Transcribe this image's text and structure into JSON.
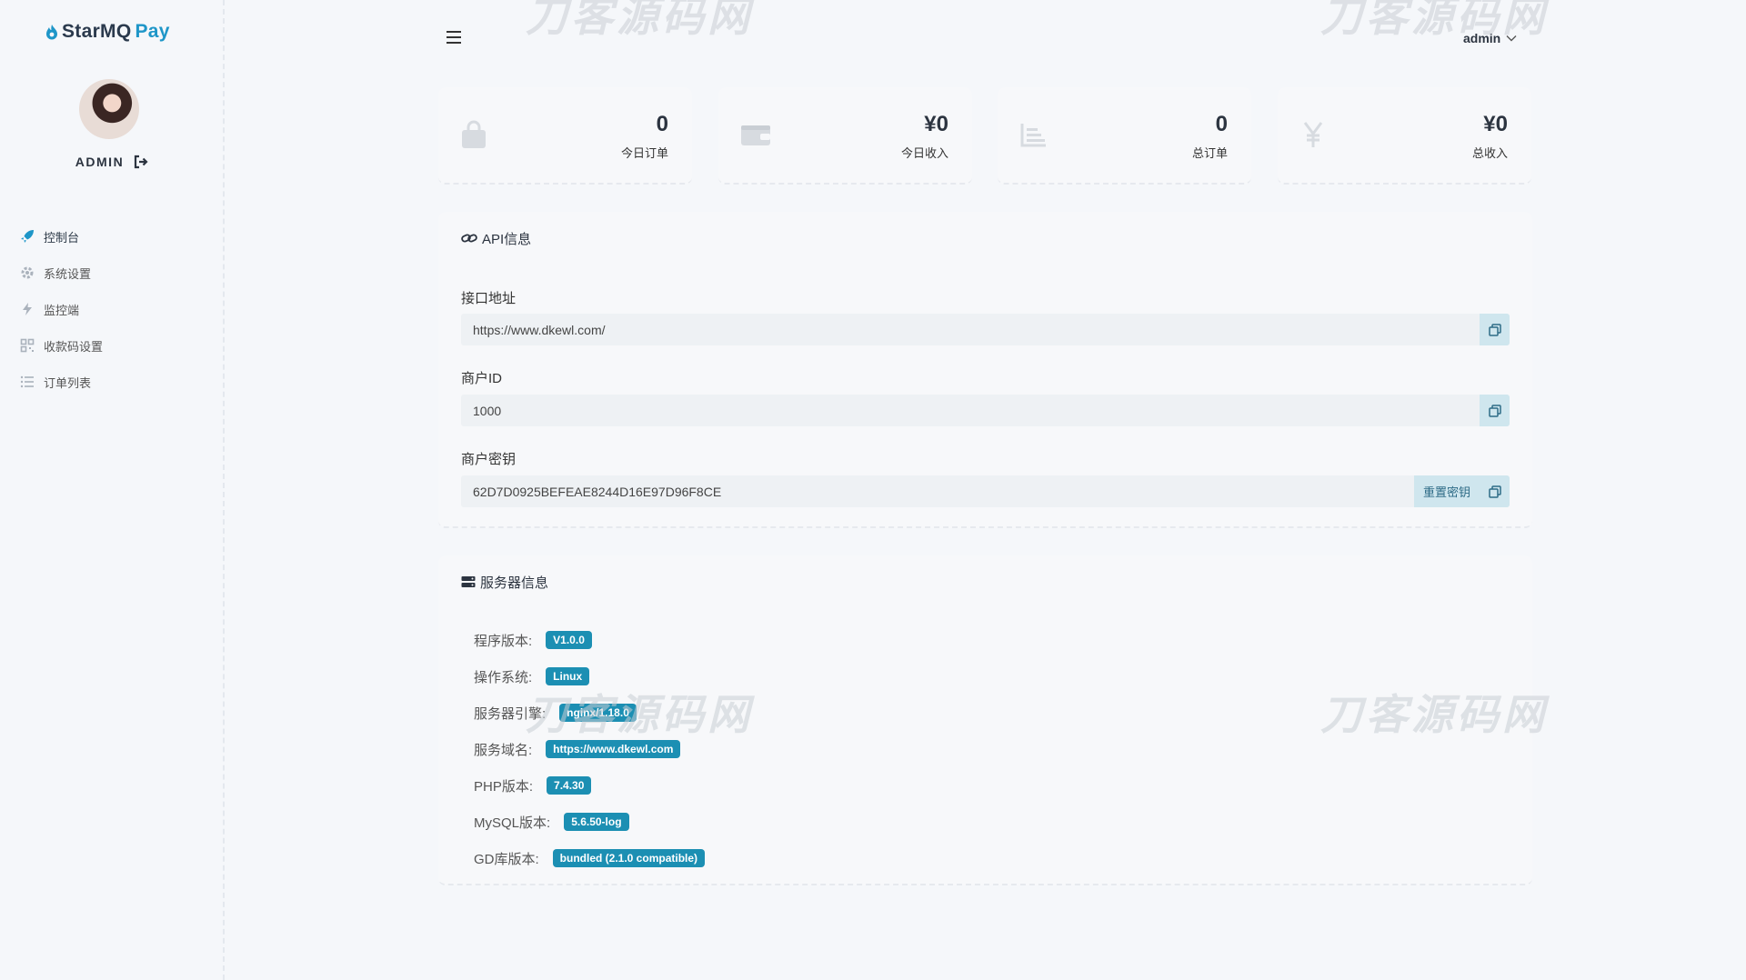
{
  "brand": {
    "part1": "StarMQ",
    "part2": "Pay",
    "color": "#1e96c8"
  },
  "user": {
    "name": "ADMIN",
    "header_name": "admin"
  },
  "nav": [
    {
      "label": "控制台",
      "icon": "rocket-icon"
    },
    {
      "label": "系统设置",
      "icon": "gear-icon"
    },
    {
      "label": "监控端",
      "icon": "bolt-icon"
    },
    {
      "label": "收款码设置",
      "icon": "qrcode-icon"
    },
    {
      "label": "订单列表",
      "icon": "list-icon"
    }
  ],
  "stats": [
    {
      "value": "0",
      "label": "今日订单",
      "icon": "shopping-bag-icon"
    },
    {
      "value": "¥0",
      "label": "今日收入",
      "icon": "wallet-icon"
    },
    {
      "value": "0",
      "label": "总订单",
      "icon": "chart-icon"
    },
    {
      "value": "¥0",
      "label": "总收入",
      "icon": "yen-icon"
    }
  ],
  "api": {
    "title": "API信息",
    "endpoint_label": "接口地址",
    "endpoint_value": "https://www.dkewl.com/",
    "merchant_id_label": "商户ID",
    "merchant_id_value": "1000",
    "secret_label": "商户密钥",
    "secret_value": "62D7D0925BEFEAE8244D16E97D96F8CE",
    "reset_label": "重置密钥"
  },
  "server": {
    "title": "服务器信息",
    "rows": [
      {
        "label": "程序版本:",
        "value": "V1.0.0"
      },
      {
        "label": "操作系统:",
        "value": "Linux"
      },
      {
        "label": "服务器引擎:",
        "value": "nginx/1.18.0"
      },
      {
        "label": "服务域名:",
        "value": "https://www.dkewl.com"
      },
      {
        "label": "PHP版本:",
        "value": "7.4.30"
      },
      {
        "label": "MySQL版本:",
        "value": "5.6.50-log"
      },
      {
        "label": "GD库版本:",
        "value": "bundled (2.1.0 compatible)"
      }
    ],
    "badge_color": "#1c8fb3"
  },
  "watermark": "刀客源码网"
}
